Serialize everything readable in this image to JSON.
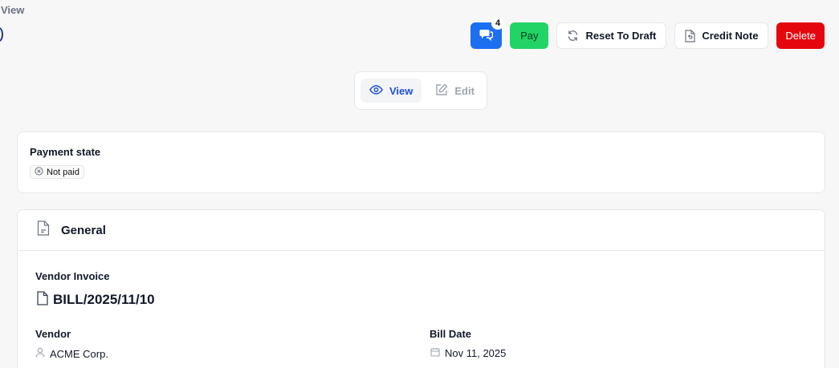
{
  "breadcrumb": "View",
  "actions": {
    "messages_count": "4",
    "pay_label": "Pay",
    "reset_label": "Reset To Draft",
    "credit_label": "Credit Note",
    "delete_label": "Delete"
  },
  "mode": {
    "view_label": "View",
    "edit_label": "Edit",
    "active": "view"
  },
  "payment": {
    "label": "Payment state",
    "state": "Not paid"
  },
  "general": {
    "title": "General",
    "vendor_invoice_label": "Vendor Invoice",
    "vendor_invoice_value": "BILL/2025/11/10",
    "vendor_label": "Vendor",
    "vendor_value": "ACME Corp.",
    "bill_date_label": "Bill Date",
    "bill_date_value": "Nov 11, 2025"
  },
  "colors": {
    "primary": "#1d6ff2",
    "pay": "#22d365",
    "danger": "#e5070e",
    "view_active": "#1d4ed8"
  }
}
